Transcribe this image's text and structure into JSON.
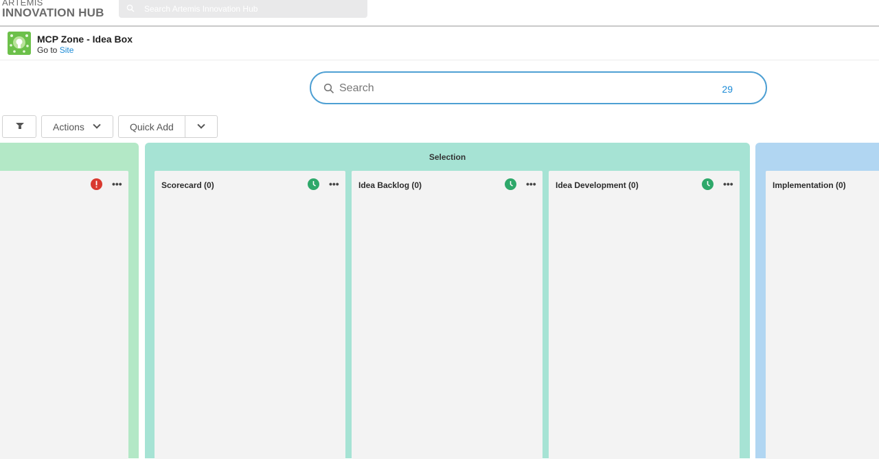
{
  "brand": {
    "line1": "ARTEMIS",
    "line2": "INNOVATION HUB"
  },
  "top_search": {
    "placeholder": "Search Artemis Innovation Hub",
    "icon": "search-icon"
  },
  "zone": {
    "title": "MCP Zone - Idea Box",
    "goto_prefix": "Go to",
    "goto_link": "Site"
  },
  "main_search": {
    "placeholder": "Search",
    "count": "29",
    "icon": "search-icon"
  },
  "toolbar": {
    "filter_icon": "filter-icon",
    "actions_label": "Actions",
    "quick_add_label": "Quick Add"
  },
  "phases": {
    "selection": {
      "title": "Selection"
    }
  },
  "stages": [
    {
      "title": "",
      "status": "alert",
      "status_color": "#d9392f"
    },
    {
      "title": "Scorecard (0)",
      "status": "clock",
      "status_color": "#2ea86a"
    },
    {
      "title": "Idea Backlog (0)",
      "status": "clock",
      "status_color": "#2ea86a"
    },
    {
      "title": "Idea Development (0)",
      "status": "clock",
      "status_color": "#2ea86a"
    },
    {
      "title": "Implementation (0)",
      "status": "",
      "status_color": ""
    }
  ],
  "more_label": "•••",
  "colors": {
    "phase_left": "#b3e8c6",
    "phase_selection": "#a6e3d4",
    "phase_implementation": "#b1d6f2",
    "search_border": "#4d9fd3",
    "link": "#1a8ad6"
  }
}
